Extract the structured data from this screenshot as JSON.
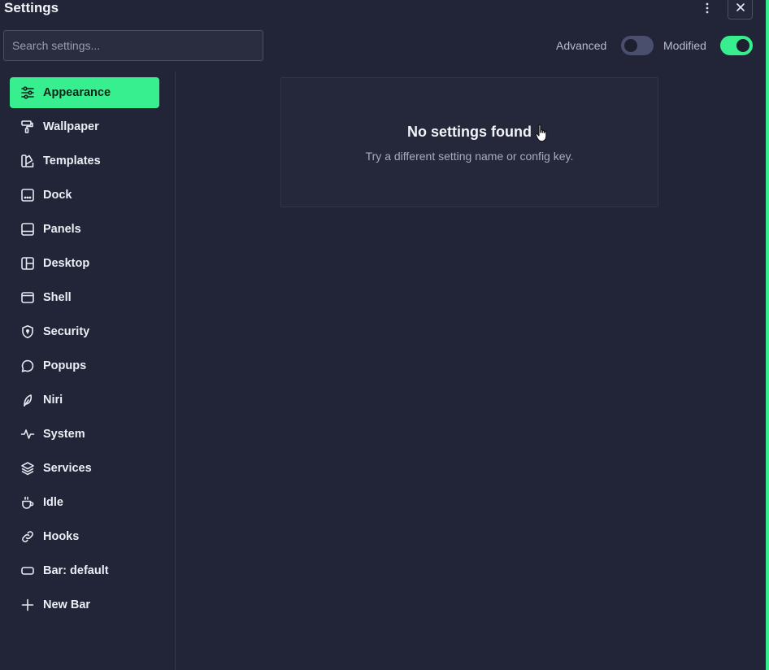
{
  "window": {
    "title": "Settings"
  },
  "search": {
    "placeholder": "Search settings..."
  },
  "toggles": {
    "advanced": {
      "label": "Advanced",
      "on": false
    },
    "modified": {
      "label": "Modified",
      "on": true
    }
  },
  "colors": {
    "accent": "#37ef8f",
    "background": "#222437",
    "card": "#25283b"
  },
  "sidebar": {
    "items": [
      {
        "label": "Appearance",
        "icon": "sliders-icon",
        "active": true
      },
      {
        "label": "Wallpaper",
        "icon": "paint-roller-icon"
      },
      {
        "label": "Templates",
        "icon": "swatches-icon"
      },
      {
        "label": "Dock",
        "icon": "dock-icon"
      },
      {
        "label": "Panels",
        "icon": "panel-icon"
      },
      {
        "label": "Desktop",
        "icon": "layout-icon"
      },
      {
        "label": "Shell",
        "icon": "window-icon"
      },
      {
        "label": "Security",
        "icon": "shield-icon"
      },
      {
        "label": "Popups",
        "icon": "chat-bubble-icon"
      },
      {
        "label": "Niri",
        "icon": "feather-icon"
      },
      {
        "label": "System",
        "icon": "activity-icon"
      },
      {
        "label": "Services",
        "icon": "layers-icon"
      },
      {
        "label": "Idle",
        "icon": "coffee-icon"
      },
      {
        "label": "Hooks",
        "icon": "link-icon"
      },
      {
        "label": "Bar: default",
        "icon": "bar-icon"
      },
      {
        "label": "New Bar",
        "icon": "plus-icon"
      }
    ]
  },
  "empty_state": {
    "title": "No settings found",
    "subtitle": "Try a different setting name or config key."
  }
}
